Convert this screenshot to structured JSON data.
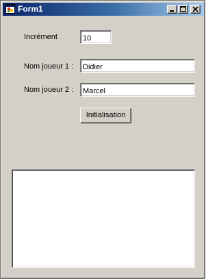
{
  "window": {
    "title": "Form1",
    "icon": "app-window-icon",
    "buttons": {
      "minimize": "minimize-icon",
      "maximize": "maximize-icon",
      "close": "close-icon"
    }
  },
  "form": {
    "increment_label": "Incrément",
    "increment_value": "10",
    "player1_label": "Nom joueur 1 :",
    "player1_value": "Didier",
    "player2_label": "Nom joueur 2 :",
    "player2_value": "Marcel",
    "init_button_label": "Initialisation"
  },
  "output": {
    "items": []
  },
  "colors": {
    "form_background": "#d4d0c8",
    "titlebar_start": "#0a246a",
    "titlebar_end": "#a6caf0"
  }
}
